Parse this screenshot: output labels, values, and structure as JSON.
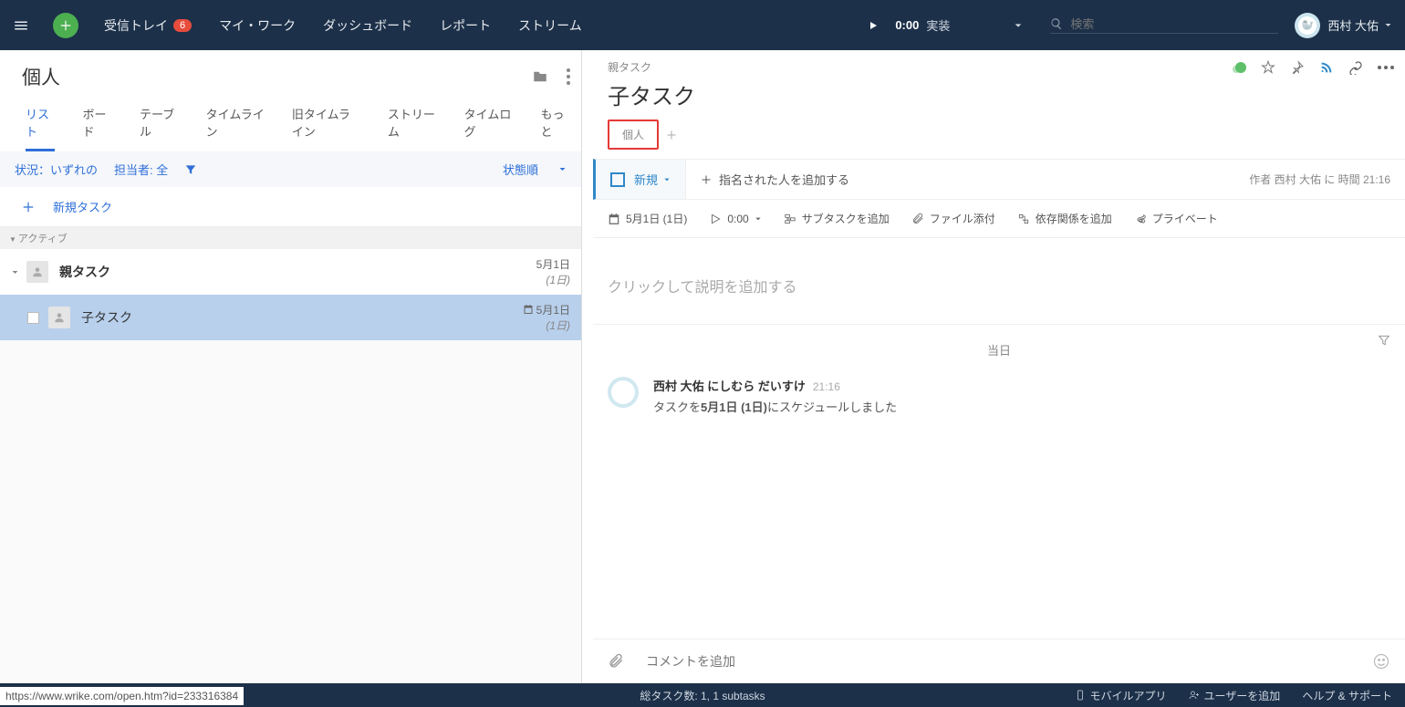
{
  "topbar": {
    "inbox": "受信トレイ",
    "inbox_badge": "6",
    "mywork": "マイ・ワーク",
    "dashboards": "ダッシュボード",
    "reports": "レポート",
    "stream": "ストリーム",
    "timer": "0:00",
    "timer_label": "実装",
    "search_placeholder": "検索",
    "username": "西村 大佑"
  },
  "left": {
    "title": "個人",
    "tabs": {
      "list": "リスト",
      "board": "ボード",
      "table": "テーブル",
      "timeline": "タイムライン",
      "old_timeline": "旧タイムライン",
      "stream": "ストリーム",
      "timelog": "タイムログ",
      "more": "もっと"
    },
    "filter_status": "状況：いずれの",
    "filter_assignee": "担当者: 全",
    "sort": "状態順",
    "new_task": "新規タスク",
    "group_active": "アクティブ",
    "parent": {
      "title": "親タスク",
      "date": "5月1日",
      "dur": "(1日)"
    },
    "child": {
      "title": "子タスク",
      "date": "5月1日",
      "dur": "(1日)"
    }
  },
  "right": {
    "breadcrumb": "親タスク",
    "title": "子タスク",
    "tag": "個人",
    "status": "新規",
    "add_assignee": "指名された人を追加する",
    "author_line": "作者 西村 大佑 に 時間 21:16",
    "actions": {
      "date": "5月1日 (1日)",
      "time": "0:00",
      "subtask": "サブタスクを追加",
      "attach": "ファイル添付",
      "dependency": "依存関係を追加",
      "private": "プライベート"
    },
    "desc_placeholder": "クリックして説明を追加する",
    "today": "当日",
    "activity": {
      "name": "西村 大佑 にしむら だいすけ",
      "time": "21:16",
      "text_pre": "タスクを",
      "text_bold": "5月1日 (1日)",
      "text_post": "にスケジュールしました"
    },
    "comment_placeholder": "コメントを追加"
  },
  "footer": {
    "url": "https://www.wrike.com/open.htm?id=233316384",
    "stats": "総タスク数: 1, 1 subtasks",
    "mobile": "モバイルアプリ",
    "add_user": "ユーザーを追加",
    "help": "ヘルプ & サポート"
  }
}
